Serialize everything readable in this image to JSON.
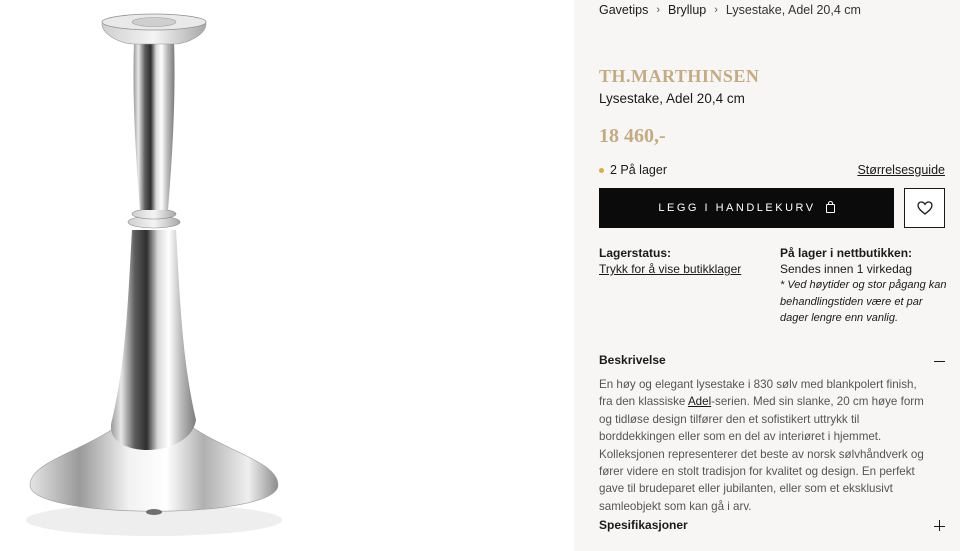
{
  "breadcrumb": {
    "items": [
      "Gavetips",
      "Bryllup"
    ],
    "separator": "›",
    "current": "Lysestake, Adel 20,4 cm"
  },
  "product": {
    "brand": "TH.MARTHINSEN",
    "name": "Lysestake, Adel 20,4 cm",
    "price": "18 460,-",
    "stock_text": "2 På lager",
    "stock_dot_color": "#d4b04c",
    "size_guide": "Størrelsesguide",
    "add_to_cart": "LEGG I HANDLEKURV",
    "image_alt": "silver-candlestick"
  },
  "availability": {
    "store_title": "Lagerstatus:",
    "store_link": "Trykk for å vise butikklager",
    "online_title": "På lager i nettbutikken:",
    "online_shipping": "Sendes innen 1 virkedag",
    "online_note": "* Ved høytider og stor pågang kan behandlingstiden være et par dager lengre enn vanlig."
  },
  "sections": {
    "description_title": "Beskrivelse",
    "description_before": "En høy og elegant lysestake i 830 sølv med blankpolert finish, fra den klassiske ",
    "description_link": "Adel",
    "description_after": "-serien. Med sin slanke, 20 cm høye form og tidløse design tilfører den et sofistikert uttrykk til borddekkingen eller som en del av interiøret i hjemmet. Kolleksjonen representerer det beste av norsk sølvhåndverk og fører videre en stolt tradisjon for kvalitet og design. En perfekt gave til brudeparet eller jubilanten, eller som et eksklusivt samleobjekt som kan gå i arv.",
    "specs_title": "Spesifikasjoner"
  },
  "colors": {
    "accent_gold": "#c3ab85",
    "button_black": "#0b0b0b",
    "panel_bg": "#f7f6f4"
  }
}
